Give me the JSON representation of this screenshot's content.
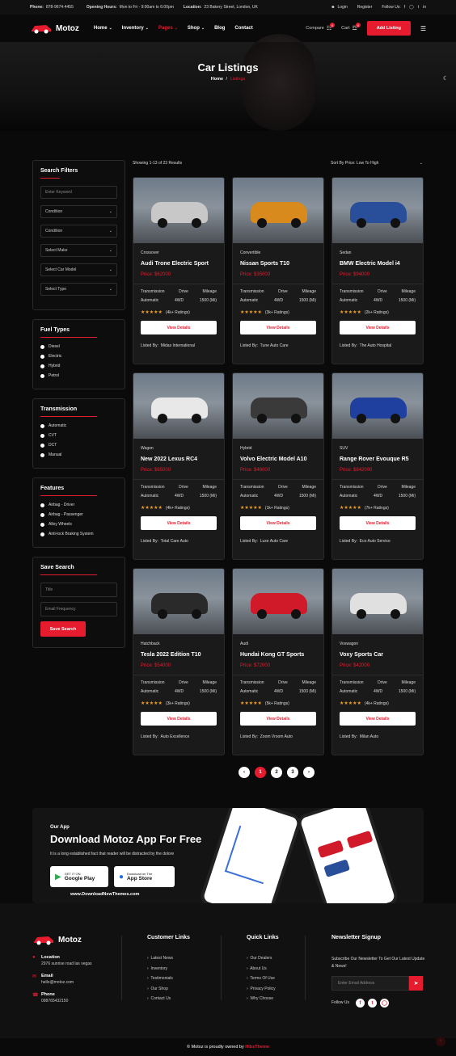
{
  "topbar": {
    "phone_label": "Phone:",
    "phone": "878-9674-4455",
    "hours_label": "Opening Hours:",
    "hours": "Mon to Fri - 9:00am to 6:00pm",
    "location_label": "Location:",
    "location": "23 Bakery Street, London, UK",
    "login": "Login",
    "register": "Register",
    "follow": "Follow Us:"
  },
  "nav": {
    "brand": "Motoz",
    "items": [
      "Home",
      "Inventory",
      "Pages",
      "Shop",
      "Blog",
      "Contact"
    ],
    "active": "Pages",
    "compare": "Compare",
    "compare_count": "0",
    "cart": "Cart",
    "cart_count": "0",
    "add_listing": "Add Listing"
  },
  "hero": {
    "title": "Car Listings",
    "crumb_home": "Home",
    "crumb_sep": "/",
    "crumb_current": "Listings"
  },
  "results": {
    "showing": "Showing 1-13 of 23 Results",
    "sort": "Sort By Price: Low To High"
  },
  "filters": {
    "title": "Search Filters",
    "keyword_placeholder": "Enter Keyword",
    "selects": [
      "Condition",
      "Condition",
      "Select Make",
      "Select Car Model",
      "Select Type"
    ]
  },
  "fuel": {
    "title": "Fuel Types",
    "items": [
      "Diesel",
      "Electric",
      "Hybrid",
      "Petrol"
    ]
  },
  "transmission": {
    "title": "Transmission",
    "items": [
      "Automatic",
      "CVT",
      "DCT",
      "Manual"
    ]
  },
  "features": {
    "title": "Features",
    "items": [
      "Airbag - Driver",
      "Airbag - Passenger",
      "Alloy Wheels",
      "Anti-lock Braking System"
    ]
  },
  "save": {
    "title": "Save Search",
    "title_placeholder": "Title",
    "email_placeholder": "Email Frequency",
    "button": "Save Search"
  },
  "card_labels": {
    "transmission": "Transmission",
    "drive": "Drive",
    "mileage": "Mileage",
    "price_prefix": "Price:",
    "listed_by": "Listed By:",
    "view": "View Details"
  },
  "cars": [
    {
      "cat": "Crossover",
      "name": "Audi Trone Electric Sport",
      "price": "$62000",
      "trans": "Automatic",
      "drive": "4WD",
      "mileage": "1500 (Mi)",
      "ratings": "(4k+ Ratings)",
      "dealer": "Midas International",
      "color": "#c8c8c8"
    },
    {
      "cat": "Convertible",
      "name": "Nissan Sports T10",
      "price": "$35000",
      "trans": "Automatic",
      "drive": "4WD",
      "mileage": "1500 (Mi)",
      "ratings": "(3k+ Ratings)",
      "dealer": "Tune Auto Care",
      "color": "#d98a1c"
    },
    {
      "cat": "Sedan",
      "name": "BMW Electric Model i4",
      "price": "$94000",
      "trans": "Automatic",
      "drive": "4WD",
      "mileage": "1500 (Mi)",
      "ratings": "(2k+ Ratings)",
      "dealer": "The Auto Hospital",
      "color": "#2a4f9a"
    },
    {
      "cat": "Wagon",
      "name": "New 2022 Lexus RC4",
      "price": "$65000",
      "trans": "Automatic",
      "drive": "4WD",
      "mileage": "1500 (Mi)",
      "ratings": "(4k+ Ratings)",
      "dealer": "Total Care Auto",
      "color": "#e8e8e8"
    },
    {
      "cat": "Hybrid",
      "name": "Volvo Electric Model A10",
      "price": "$46000",
      "trans": "Automatic",
      "drive": "4WD",
      "mileage": "1500 (Mi)",
      "ratings": "(1k+ Ratings)",
      "dealer": "Luxe Auto Care",
      "color": "#3a3a3a"
    },
    {
      "cat": "SUV",
      "name": "Range Rover Evouque R5",
      "price": "$842000",
      "trans": "Automatic",
      "drive": "4WD",
      "mileage": "1500 (Mi)",
      "ratings": "(7k+ Ratings)",
      "dealer": "Eco Auto Service",
      "color": "#2040a0"
    },
    {
      "cat": "Hatchback",
      "name": "Tesla 2022 Edition T10",
      "price": "$54000",
      "trans": "Automatic",
      "drive": "4WD",
      "mileage": "1500 (Mi)",
      "ratings": "(3k+ Ratings)",
      "dealer": "Auto Excellence",
      "color": "#2a2a2a"
    },
    {
      "cat": "Audi",
      "name": "Hundai Kong GT Sports",
      "price": "$72000",
      "trans": "Automatic",
      "drive": "4WD",
      "mileage": "1500 (Mi)",
      "ratings": "(5k+ Ratings)",
      "dealer": "Zoom Vroom Auto",
      "color": "#d01a2a"
    },
    {
      "cat": "Voxwagon",
      "name": "Voxy Sports Car",
      "price": "$42000",
      "trans": "Automatic",
      "drive": "4WD",
      "mileage": "1500 (Mi)",
      "ratings": "(4k+ Ratings)",
      "dealer": "Milan Auto",
      "color": "#e0e0e0"
    }
  ],
  "pagination": {
    "prev": "‹",
    "pages": [
      "1",
      "2",
      "3"
    ],
    "current": "1",
    "next": "›"
  },
  "app": {
    "eyebrow": "Our App",
    "title": "Download Motoz App For Free",
    "desc": "It is a long established fact that reader will be distracted by the dolore",
    "gp_small": "GET IT ON",
    "gp_big": "Google Play",
    "as_small": "Download on The",
    "as_big": "App Store",
    "site": "www.DownloadNewThemes.com"
  },
  "footer": {
    "brand": "Motoz",
    "location_label": "Location",
    "location": "2976 sunrise road las vegas",
    "email_label": "Email",
    "email": "hello@motoz.com",
    "phone_label": "Phone",
    "phone": "098765432150",
    "customer_title": "Customer Links",
    "customer": [
      "Latest News",
      "Inventory",
      "Testimonials",
      "Our Shop",
      "Contact Us"
    ],
    "quick_title": "Quick Links",
    "quick": [
      "Our Dealers",
      "About Us",
      "Terms Of Use",
      "Privacy Policy",
      "Why Choose"
    ],
    "news_title": "Newsletter Signup",
    "news_desc": "Subscribe Our Newsletter To Get Our Latest Update & News!",
    "news_placeholder": "Enter Email Address",
    "follow": "Follow Us",
    "copy_pre": "© Motoz is proudly owned by",
    "copy_brand": "HibsTheme"
  },
  "colors": {
    "accent": "#e61c2e",
    "bg": "#0a0a0a",
    "card": "#1a1a1a"
  }
}
